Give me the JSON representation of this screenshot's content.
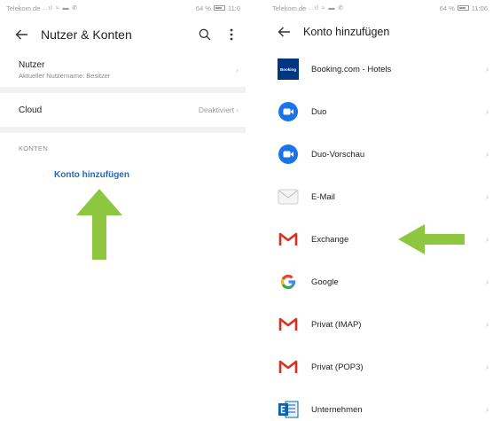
{
  "left_screen": {
    "statusbar": {
      "carrier": "Telekom.de",
      "icons": "..ıl ≈ ▬ ✆",
      "battery_text": "64 %",
      "battery_level": 64,
      "time": "11:0"
    },
    "title": "Nutzer & Konten",
    "rows": [
      {
        "title": "Nutzer",
        "subtitle": "Aktueller Nutzername: Besitzer"
      },
      {
        "title": "Cloud",
        "value": "Deaktiviert"
      }
    ],
    "section_header": "KONTEN",
    "add_account": "Konto hinzufügen"
  },
  "right_screen": {
    "statusbar": {
      "carrier": "Telekom.de",
      "icons": "..ıl ≈ ▬ ✆",
      "battery_text": "64 %",
      "battery_level": 64,
      "time": "11:06"
    },
    "title": "Konto hinzufügen",
    "booking_logo_text": "Booking",
    "accounts": [
      {
        "label": "Booking.com - Hotels",
        "icon": "booking-icon"
      },
      {
        "label": "Duo",
        "icon": "duo-icon"
      },
      {
        "label": "Duo-Vorschau",
        "icon": "duo-icon"
      },
      {
        "label": "E-Mail",
        "icon": "email-icon"
      },
      {
        "label": "Exchange",
        "icon": "gmail-icon"
      },
      {
        "label": "Google",
        "icon": "google-icon"
      },
      {
        "label": "Privat (IMAP)",
        "icon": "gmail-icon"
      },
      {
        "label": "Privat (POP3)",
        "icon": "gmail-icon"
      },
      {
        "label": "Unternehmen",
        "icon": "exchange-icon"
      }
    ]
  },
  "colors": {
    "arrow": "#8dc63f",
    "link": "#1a6ad1",
    "booking": "#003580",
    "duo": "#1a73e8",
    "gmail_red": "#d93025"
  }
}
